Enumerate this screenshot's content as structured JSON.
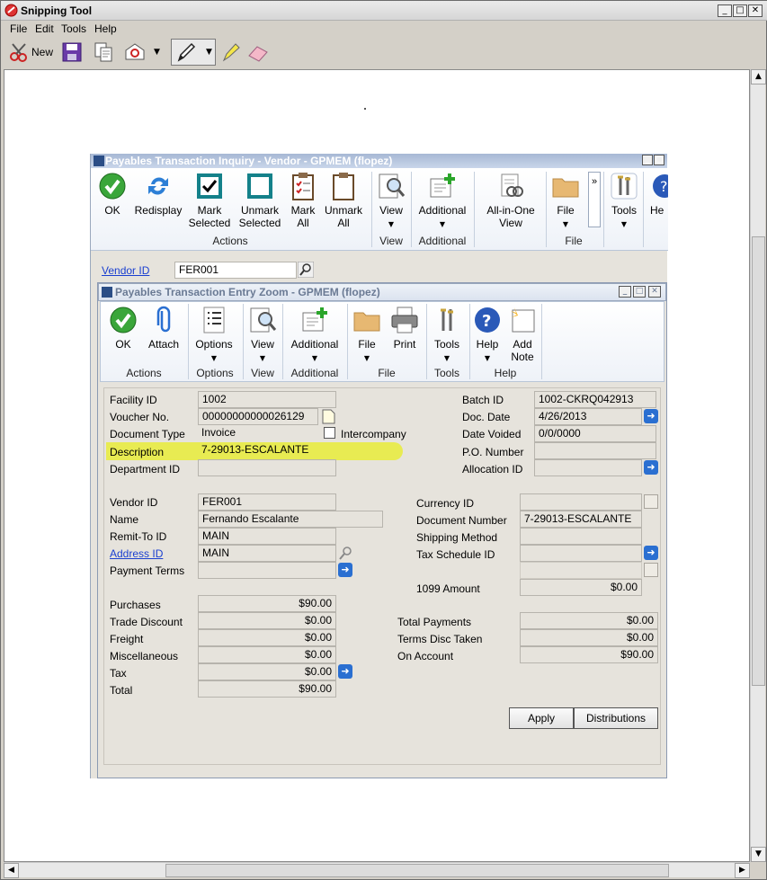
{
  "snipping": {
    "title": "Snipping Tool",
    "menu": [
      "File",
      "Edit",
      "Tools",
      "Help"
    ],
    "new_label": "New"
  },
  "inquiry": {
    "title": "Payables Transaction Inquiry - Vendor  -  GPMEM (flopez)",
    "buttons": {
      "ok": "OK",
      "redisplay": "Redisplay",
      "mark_selected_1": "Mark",
      "mark_selected_2": "Selected",
      "unmark_selected_1": "Unmark",
      "unmark_selected_2": "Selected",
      "mark_all_1": "Mark",
      "mark_all_2": "All",
      "unmark_all_1": "Unmark",
      "unmark_all_2": "All",
      "view": "View",
      "additional": "Additional",
      "all_in_one_1": "All-in-One",
      "all_in_one_2": "View",
      "file": "File",
      "more": "»",
      "tools": "Tools",
      "help_partial": "He"
    },
    "groups": {
      "actions": "Actions",
      "view": "View",
      "additional": "Additional",
      "file": "File"
    },
    "vendor_id_label": "Vendor ID",
    "vendor_id_value": "FER001"
  },
  "zoom": {
    "title": "Payables Transaction Entry Zoom  -  GPMEM (flopez)",
    "buttons": {
      "ok": "OK",
      "attach": "Attach",
      "options": "Options",
      "view": "View",
      "additional": "Additional",
      "file": "File",
      "print": "Print",
      "tools": "Tools",
      "help": "Help",
      "add_note_1": "Add",
      "add_note_2": "Note"
    },
    "groups": {
      "actions": "Actions",
      "options": "Options",
      "view": "View",
      "additional": "Additional",
      "file": "File",
      "tools": "Tools",
      "help": "Help"
    },
    "left": {
      "facility_id": {
        "label": "Facility ID",
        "value": "1002"
      },
      "voucher_no": {
        "label": "Voucher No.",
        "value": "00000000000026129"
      },
      "document_type": {
        "label": "Document Type",
        "value": "Invoice"
      },
      "intercompany": "Intercompany",
      "description": {
        "label": "Description",
        "value": "7-29013-ESCALANTE"
      },
      "department_id": {
        "label": "Department ID",
        "value": ""
      }
    },
    "right": {
      "batch_id": {
        "label": "Batch ID",
        "value": "1002-CKRQ042913"
      },
      "doc_date": {
        "label": "Doc. Date",
        "value": "4/26/2013"
      },
      "date_voided": {
        "label": "Date Voided",
        "value": "0/0/0000"
      },
      "po_number": {
        "label": "P.O. Number",
        "value": ""
      },
      "allocation_id": {
        "label": "Allocation ID",
        "value": ""
      }
    },
    "vendor": {
      "vendor_id": {
        "label": "Vendor ID",
        "value": "FER001"
      },
      "name": {
        "label": "Name",
        "value": "Fernando Escalante"
      },
      "remit_to": {
        "label": "Remit-To ID",
        "value": "MAIN"
      },
      "address_id": {
        "label": "Address ID",
        "value": "MAIN"
      },
      "payment_terms": {
        "label": "Payment Terms",
        "value": ""
      }
    },
    "currency": {
      "currency_id": {
        "label": "Currency ID",
        "value": ""
      },
      "document_number": {
        "label": "Document Number",
        "value": "7-29013-ESCALANTE"
      },
      "shipping_method": {
        "label": "Shipping Method",
        "value": ""
      },
      "tax_schedule_id": {
        "label": "Tax Schedule ID",
        "value": ""
      },
      "amount_1099": {
        "label": "1099 Amount",
        "value": "$0.00"
      }
    },
    "amounts": {
      "purchases": {
        "label": "Purchases",
        "value": "$90.00"
      },
      "trade_discount": {
        "label": "Trade Discount",
        "value": "$0.00"
      },
      "freight": {
        "label": "Freight",
        "value": "$0.00"
      },
      "miscellaneous": {
        "label": "Miscellaneous",
        "value": "$0.00"
      },
      "tax": {
        "label": "Tax",
        "value": "$0.00"
      },
      "total": {
        "label": "Total",
        "value": "$90.00"
      }
    },
    "payments": {
      "total_payments": {
        "label": "Total Payments",
        "value": "$0.00"
      },
      "terms_disc_taken": {
        "label": "Terms Disc Taken",
        "value": "$0.00"
      },
      "on_account": {
        "label": "On Account",
        "value": "$90.00"
      }
    },
    "apply_label": "Apply",
    "distributions_label": "Distributions"
  },
  "colors": {
    "highlight": "#e8ec3a",
    "link": "#1a3fd0",
    "arrow_button": "#2a6fd1"
  }
}
